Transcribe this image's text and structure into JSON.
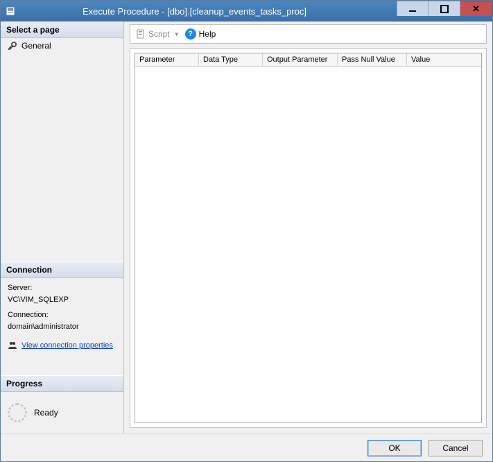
{
  "window": {
    "title": "Execute Procedure - [dbo].[cleanup_events_tasks_proc]"
  },
  "sidebar": {
    "select_page_header": "Select a page",
    "items": [
      {
        "label": "General"
      }
    ],
    "connection_header": "Connection",
    "server_label": "Server:",
    "server_value": "VC\\VIM_SQLEXP",
    "connection_label": "Connection:",
    "connection_value": "domain\\administrator",
    "view_connection_link": "View connection properties",
    "progress_header": "Progress",
    "progress_status": "Ready"
  },
  "toolbar": {
    "script_label": "Script",
    "help_label": "Help"
  },
  "grid": {
    "columns": {
      "c0": "Parameter",
      "c1": "Data Type",
      "c2": "Output Parameter",
      "c3": "Pass Null Value",
      "c4": "Value"
    }
  },
  "footer": {
    "ok_label": "OK",
    "cancel_label": "Cancel"
  }
}
